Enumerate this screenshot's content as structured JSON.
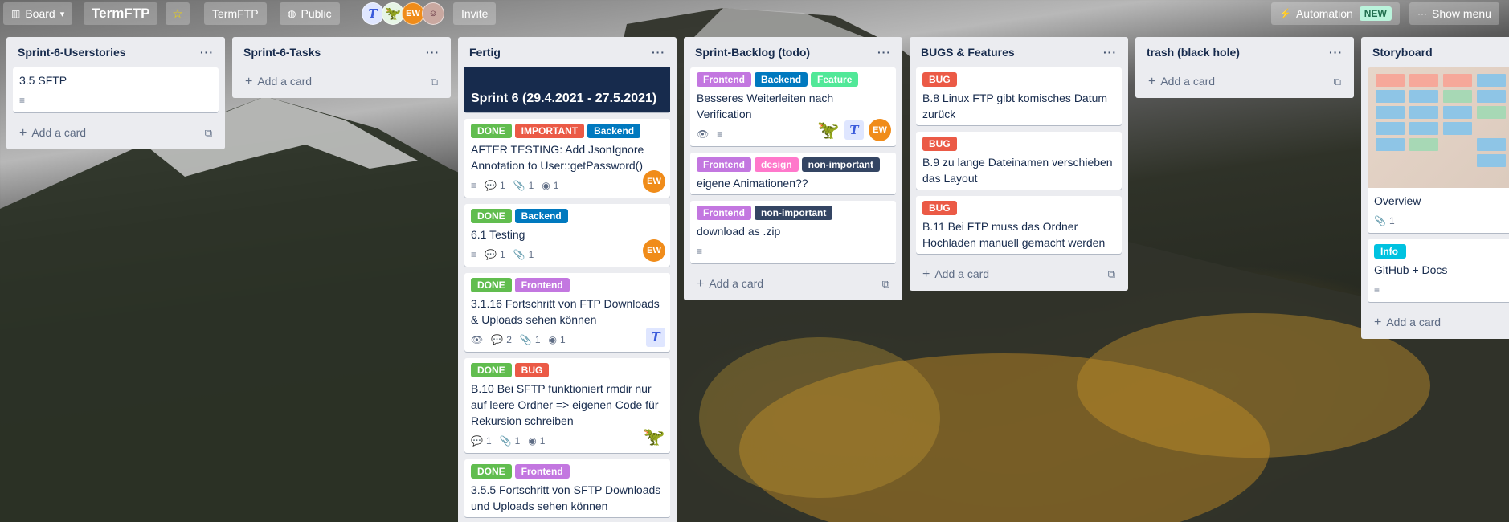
{
  "topbar": {
    "board_btn": "Board",
    "title": "TermFTP",
    "workspace": "TermFTP",
    "visibility": "Public",
    "invite": "Invite",
    "automation": "Automation",
    "automation_badge": "NEW",
    "show_menu": "Show menu",
    "avatars": [
      "T",
      "dino",
      "EW",
      "photo"
    ]
  },
  "add_card_label": "Add a card",
  "colors": {
    "green": "#61bd4f",
    "red": "#eb5a46",
    "blue": "#0079bf",
    "purple": "#c377e0",
    "lime": "#51e898",
    "pink": "#ff78cb",
    "navy": "#344563",
    "sky": "#00c2e0"
  },
  "lists": [
    {
      "title": "Sprint-6-Userstories",
      "cards": [
        {
          "text": "3.5 SFTP"
        }
      ]
    },
    {
      "title": "Sprint-6-Tasks",
      "cards": []
    },
    {
      "title": "Fertig",
      "sprint_header": "Sprint 6 (29.4.2021 - 27.5.2021)",
      "cards": [
        {
          "labels": [
            "DONE",
            "IMPORTANT",
            "Backend"
          ],
          "text": "AFTER TESTING: Add JsonIgnore Annotation to User::getPassword()",
          "comments": "1",
          "attachments": "1",
          "github": "1",
          "member": "EW"
        },
        {
          "labels": [
            "DONE",
            "Backend"
          ],
          "text": "6.1 Testing",
          "comments": "1",
          "attachments": "1",
          "member": "EW"
        },
        {
          "labels": [
            "DONE",
            "Frontend"
          ],
          "text": "3.1.16 Fortschritt von FTP Downloads & Uploads sehen können",
          "comments": "2",
          "attachments": "1",
          "github": "1",
          "member": "T"
        },
        {
          "labels": [
            "DONE",
            "BUG"
          ],
          "text": "B.10 Bei SFTP funktioniert rmdir nur auf leere Ordner => eigenen Code für Rekursion schreiben",
          "comments": "1",
          "attachments": "1",
          "github": "1"
        },
        {
          "labels": [
            "DONE",
            "Frontend"
          ],
          "text": "3.5.5 Fortschritt von SFTP Downloads und Uploads sehen können"
        }
      ]
    },
    {
      "title": "Sprint-Backlog (todo)",
      "cards": [
        {
          "labels": [
            "Frontend",
            "Backend",
            "Feature"
          ],
          "text": "Besseres Weiterleiten nach Verification",
          "member": "EW"
        },
        {
          "labels": [
            "Frontend",
            "design",
            "non-important"
          ],
          "text": "eigene Animationen??"
        },
        {
          "labels": [
            "Frontend",
            "non-important"
          ],
          "text": "download as .zip"
        }
      ]
    },
    {
      "title": "BUGS & Features",
      "cards": [
        {
          "labels": [
            "BUG"
          ],
          "text": "B.8 Linux FTP gibt komisches Datum zurück"
        },
        {
          "labels": [
            "BUG"
          ],
          "text": "B.9 zu lange Dateinamen verschieben das Layout"
        },
        {
          "labels": [
            "BUG"
          ],
          "text": "B.11 Bei FTP muss das Ordner Hochladen manuell gemacht werden"
        }
      ]
    },
    {
      "title": "trash (black hole)",
      "cards": []
    },
    {
      "title": "Storyboard",
      "cards": [
        {
          "text": "Overview",
          "attachments": "1"
        },
        {
          "labels": [
            "Info"
          ],
          "text": "GitHub + Docs"
        }
      ]
    }
  ]
}
